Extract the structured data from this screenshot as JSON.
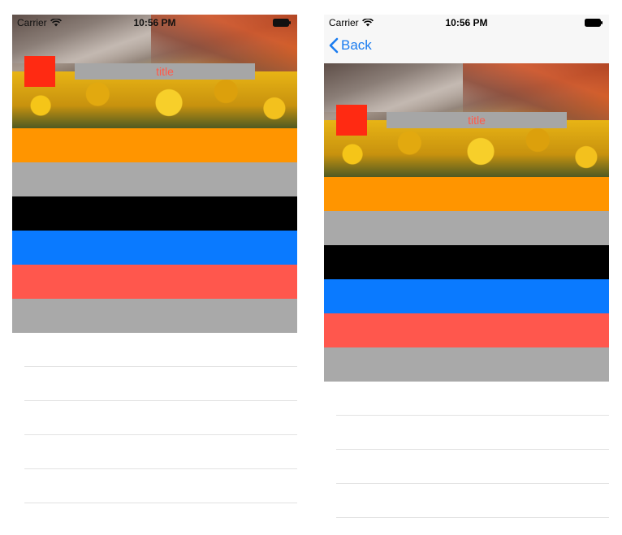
{
  "status": {
    "carrier": "Carrier",
    "time": "10:56 PM"
  },
  "nav": {
    "back_label": "Back"
  },
  "header": {
    "title": "title"
  },
  "colors": {
    "orange": "#ff9500",
    "gray": "#a9a9a9",
    "black": "#000000",
    "blue": "#0a7aff",
    "red": "#ff574d",
    "red_square": "#ff2a12",
    "title_text": "#ff5a4a",
    "back_blue": "#1a7cf0"
  },
  "rows": [
    "orange",
    "gray",
    "black",
    "blue",
    "red",
    "gray"
  ],
  "icons": {
    "wifi": "wifi-icon",
    "battery": "battery-icon",
    "back": "chevron-left-icon"
  }
}
